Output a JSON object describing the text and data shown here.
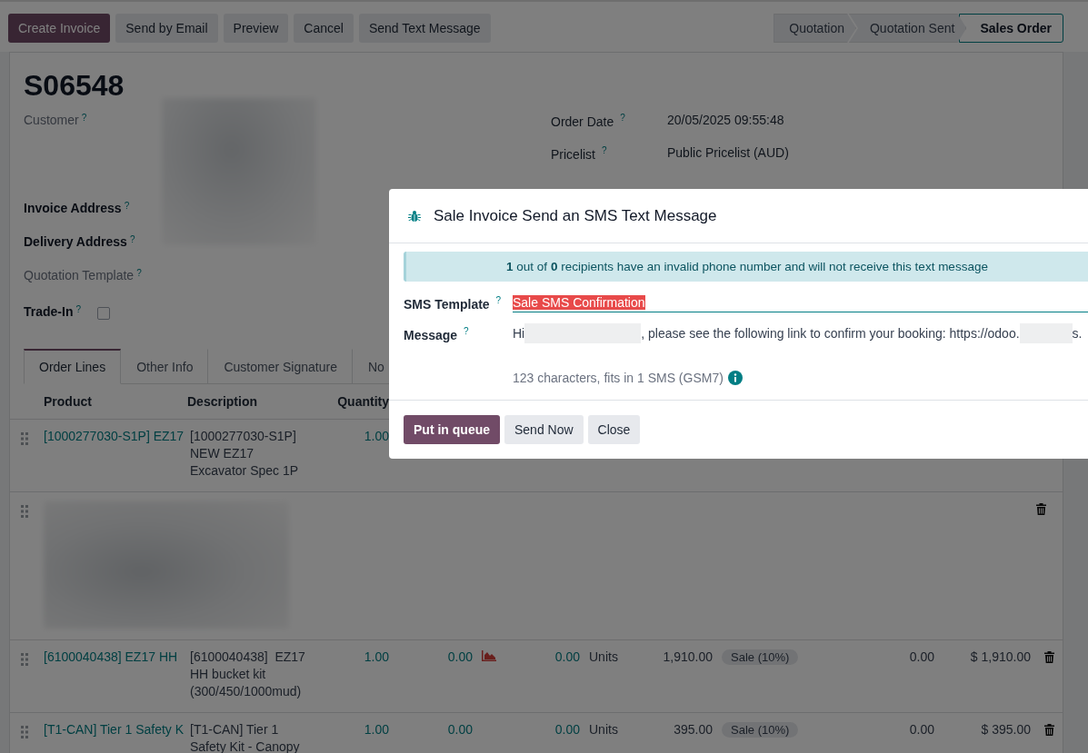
{
  "action_buttons": [
    {
      "label": "Create Invoice",
      "primary": true
    },
    {
      "label": "Send by Email",
      "primary": false
    },
    {
      "label": "Preview",
      "primary": false
    },
    {
      "label": "Cancel",
      "primary": false
    },
    {
      "label": "Send Text Message",
      "primary": false
    }
  ],
  "status_steps": [
    {
      "label": "Quotation",
      "selected": false
    },
    {
      "label": "Quotation Sent",
      "selected": false
    },
    {
      "label": "Sales Order",
      "selected": true
    }
  ],
  "record": {
    "title": "S06548",
    "left_fields": [
      {
        "label": "Customer",
        "help": "?",
        "required": false,
        "kind": "redacted"
      },
      {
        "label": "Invoice Address",
        "help": "?",
        "required": true,
        "kind": "covered"
      },
      {
        "label": "Delivery Address",
        "help": "?",
        "required": true,
        "kind": "covered"
      },
      {
        "label": "Quotation Template",
        "help": "?",
        "required": false,
        "kind": "empty"
      },
      {
        "label": "Trade-In",
        "help": "?",
        "required": true,
        "kind": "checkbox",
        "checked": false
      }
    ],
    "right_fields": [
      {
        "label": "Order Date",
        "help": "?",
        "value": "20/05/2025 09:55:48"
      },
      {
        "label": "Pricelist",
        "help": "?",
        "value": "Public Pricelist (AUD)"
      }
    ]
  },
  "tabs": [
    {
      "label": "Order Lines",
      "selected": true
    },
    {
      "label": "Other Info",
      "selected": false
    },
    {
      "label": "Customer Signature",
      "selected": false
    },
    {
      "label": "No",
      "selected": false
    }
  ],
  "table": {
    "columns": [
      "Product",
      "Description",
      "Quantity"
    ],
    "rows": [
      {
        "kind": "line",
        "product": "[1000277030-S1P] EZ17",
        "description": [
          "[1000277030-S1P]",
          "NEW EZ17",
          "Excavator Spec 1P"
        ],
        "quantity": "1.00"
      },
      {
        "kind": "redacted"
      },
      {
        "kind": "line",
        "product": "[6100040438] EZ17 HH",
        "description": [
          "[6100040438]  EZ17",
          "HH bucket kit",
          "(300/450/1000mud)"
        ],
        "quantity": "1.00",
        "delivered": "0.00",
        "forecast_warning": true,
        "invoiced": "0.00",
        "unit": "Units",
        "price": "1,910.00",
        "tax": "Sale (10%)",
        "discount": "0.00",
        "subtotal": "$ 1,910.00"
      },
      {
        "kind": "line",
        "product": "[T1-CAN] Tier 1 Safety K",
        "description": [
          "[T1-CAN] Tier 1",
          "Safety Kit - Canopy"
        ],
        "quantity": "1.00",
        "delivered": "0.00",
        "forecast_warning": false,
        "invoiced": "0.00",
        "unit": "Units",
        "price": "395.00",
        "tax": "Sale (10%)",
        "discount": "0.00",
        "subtotal": "$ 395.00"
      }
    ]
  },
  "dialog": {
    "title": "Sale Invoice Send an SMS Text Message",
    "alert": "**1** out of **0** recipients have an invalid phone number and will not receive this text message",
    "template_label": "SMS Template",
    "template_help": "?",
    "template_value": "Sale SMS Confirmation",
    "message_label": "Message",
    "message_help": "?",
    "message_parts": [
      {
        "kind": "text",
        "text": "Hi"
      },
      {
        "kind": "redacted"
      },
      {
        "kind": "text",
        "text": ", please see the following link to confirm your booking: https://odoo."
      },
      {
        "kind": "redacted"
      },
      {
        "kind": "text",
        "text": "s."
      }
    ],
    "counter": "123 characters, fits in 1 SMS (GSM7)",
    "buttons": [
      {
        "label": "Put in queue",
        "primary": true
      },
      {
        "label": "Send Now",
        "primary": false
      },
      {
        "label": "Close",
        "primary": false
      }
    ]
  }
}
